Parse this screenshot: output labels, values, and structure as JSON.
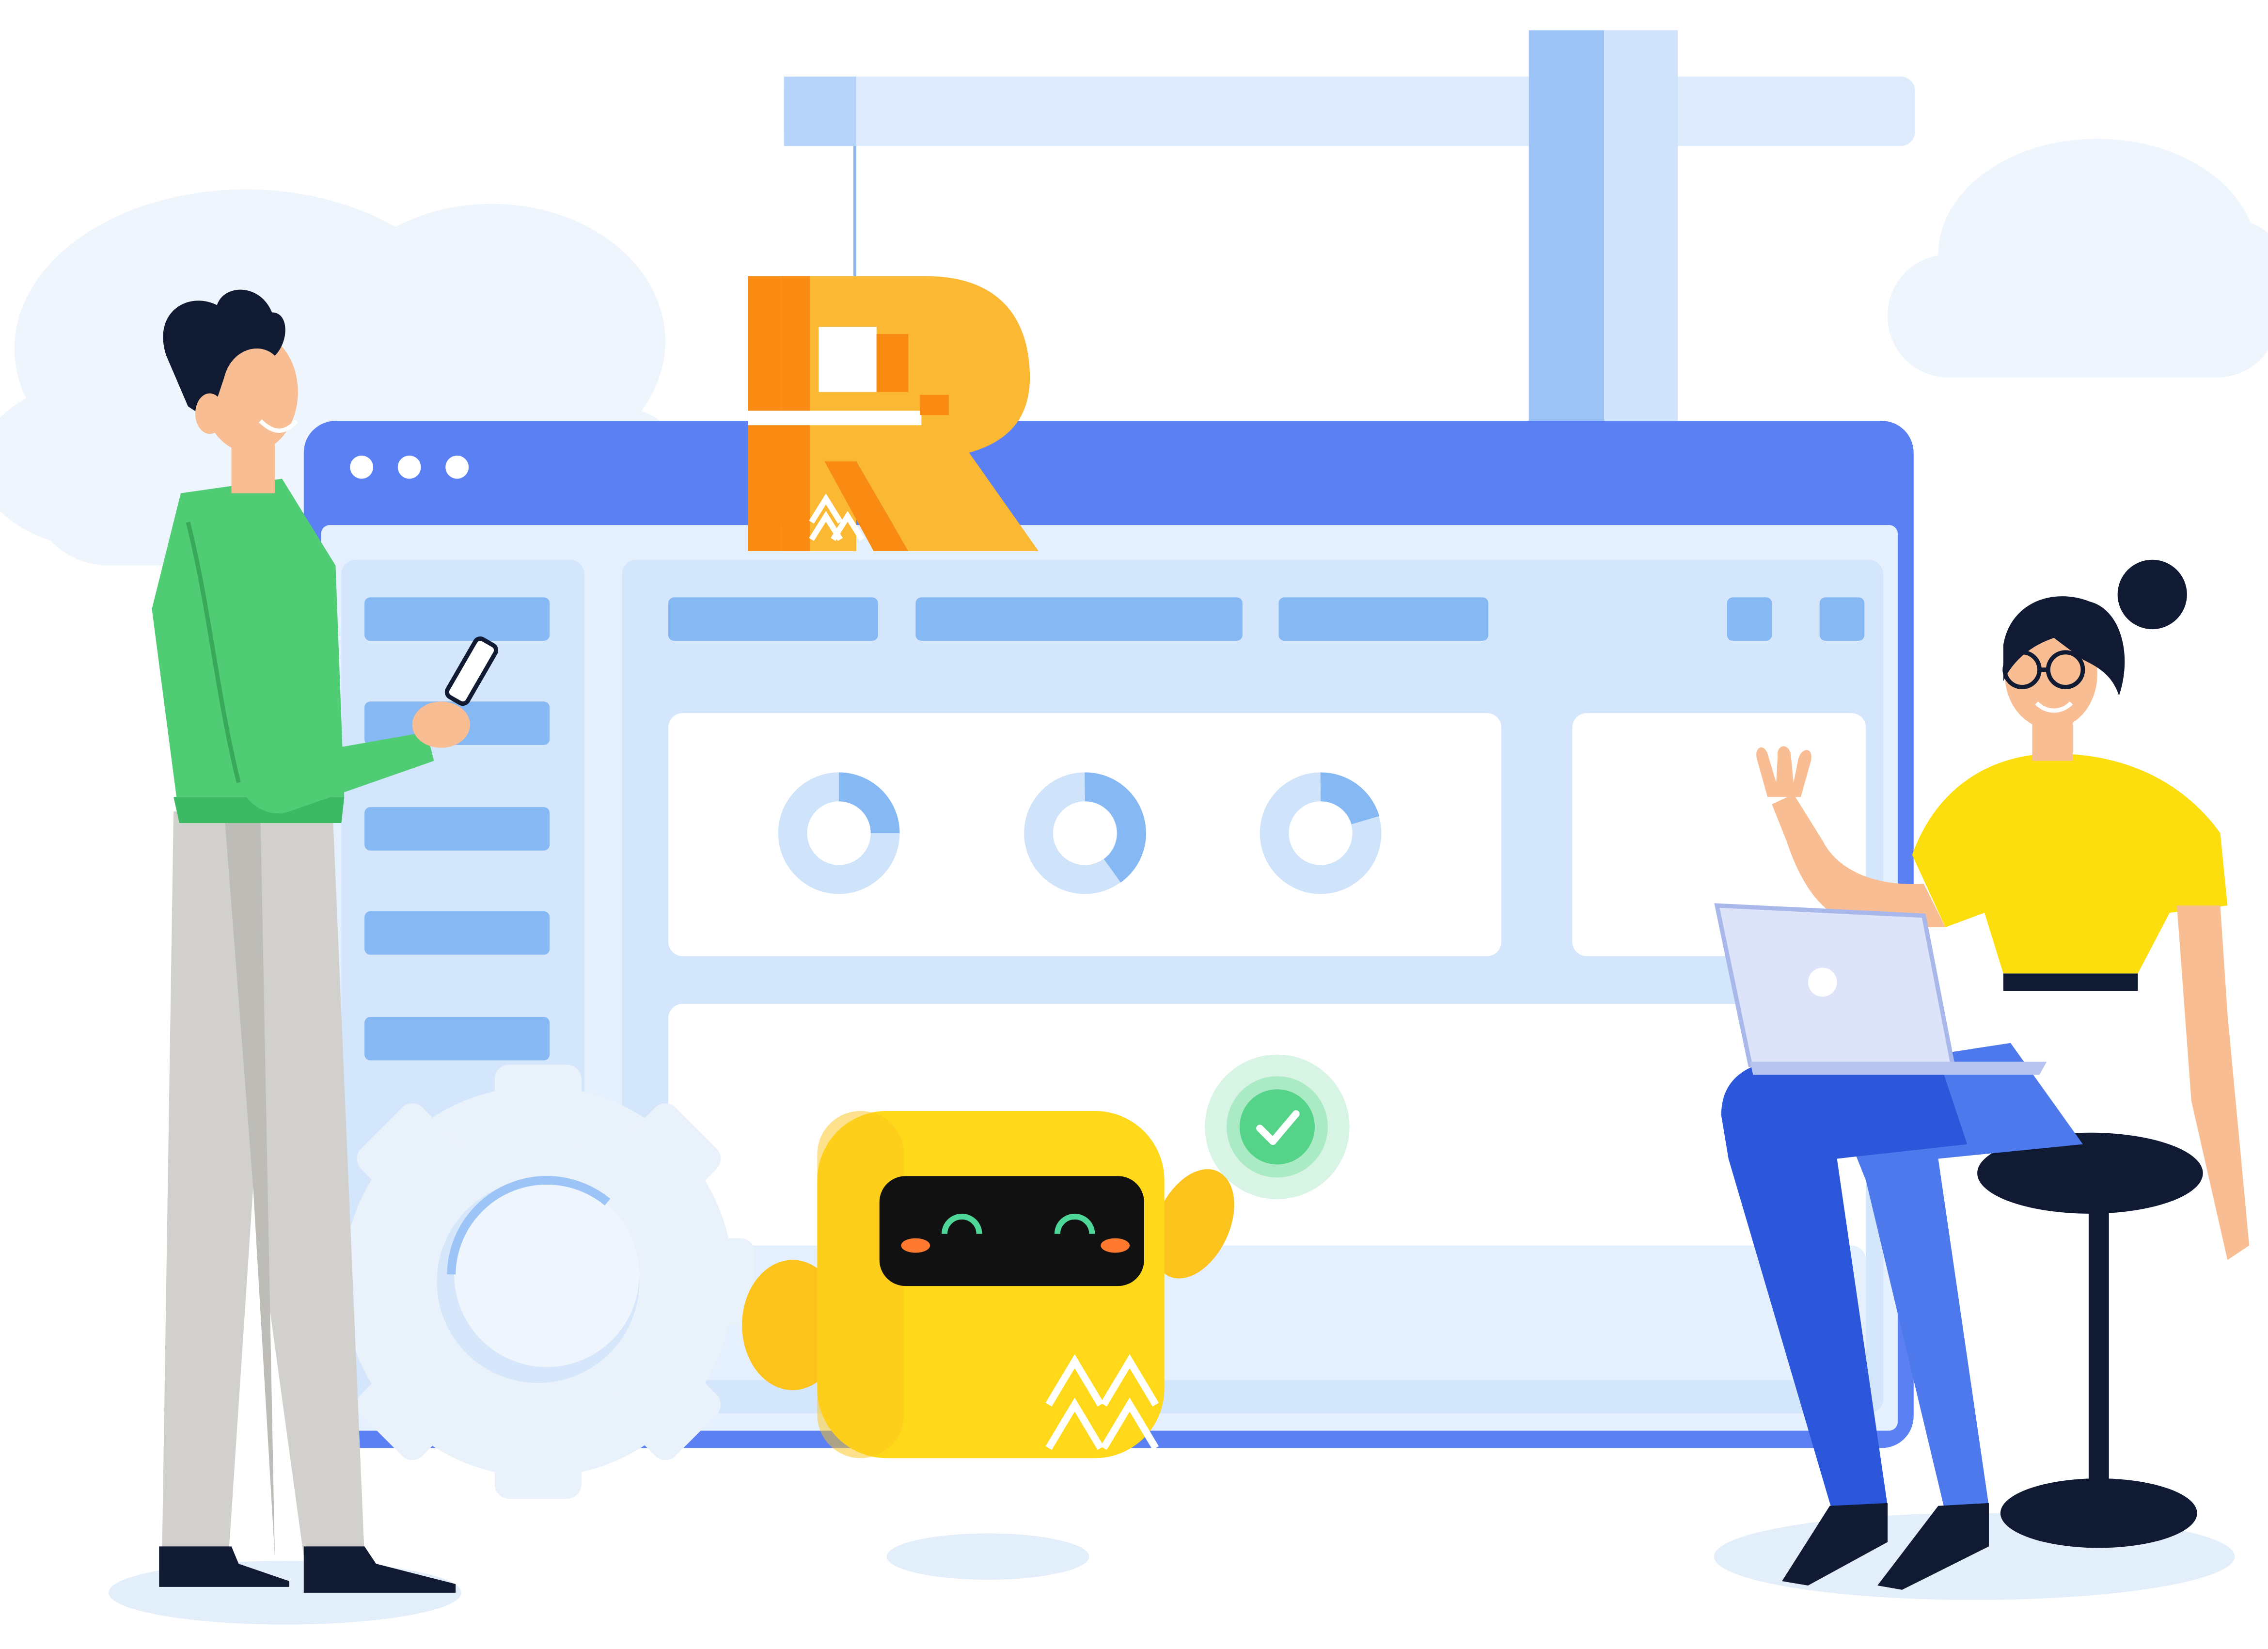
{
  "logo": {
    "letter": "R"
  },
  "colors": {
    "window_frame": "#5b80f3",
    "window_body": "#e4f0fd",
    "panel": "#ffffff",
    "skeleton_bar": "#86b8f3",
    "crane": "#cfe3fb",
    "crane_dark": "#9cc4f7",
    "cloud": "#eef5fc",
    "logo_orange": "#f98b12",
    "logo_yellow": "#fbb832",
    "robot_yellow": "#ffd919",
    "robot_visor": "#111111",
    "robot_eye": "#4fd79a",
    "robot_cheek": "#ff7a2f",
    "check_green": "#55d388",
    "man_shirt": "#50cd74",
    "man_trousers": "#d1d0cc",
    "woman_top": "#fcde0f",
    "woman_trousers": "#4d79ec",
    "hair": "#111a33",
    "skin": "#f8bd93",
    "stool": "#111a33",
    "laptop": "#dde3f8"
  },
  "icons": [
    "window-dots-icon",
    "donut-chart-icon",
    "check-badge-icon",
    "gear-icon",
    "smartphone-icon",
    "laptop-icon"
  ],
  "donuts": [
    {
      "fraction": 0.25
    },
    {
      "fraction": 0.35
    },
    {
      "fraction": 0.2
    }
  ]
}
